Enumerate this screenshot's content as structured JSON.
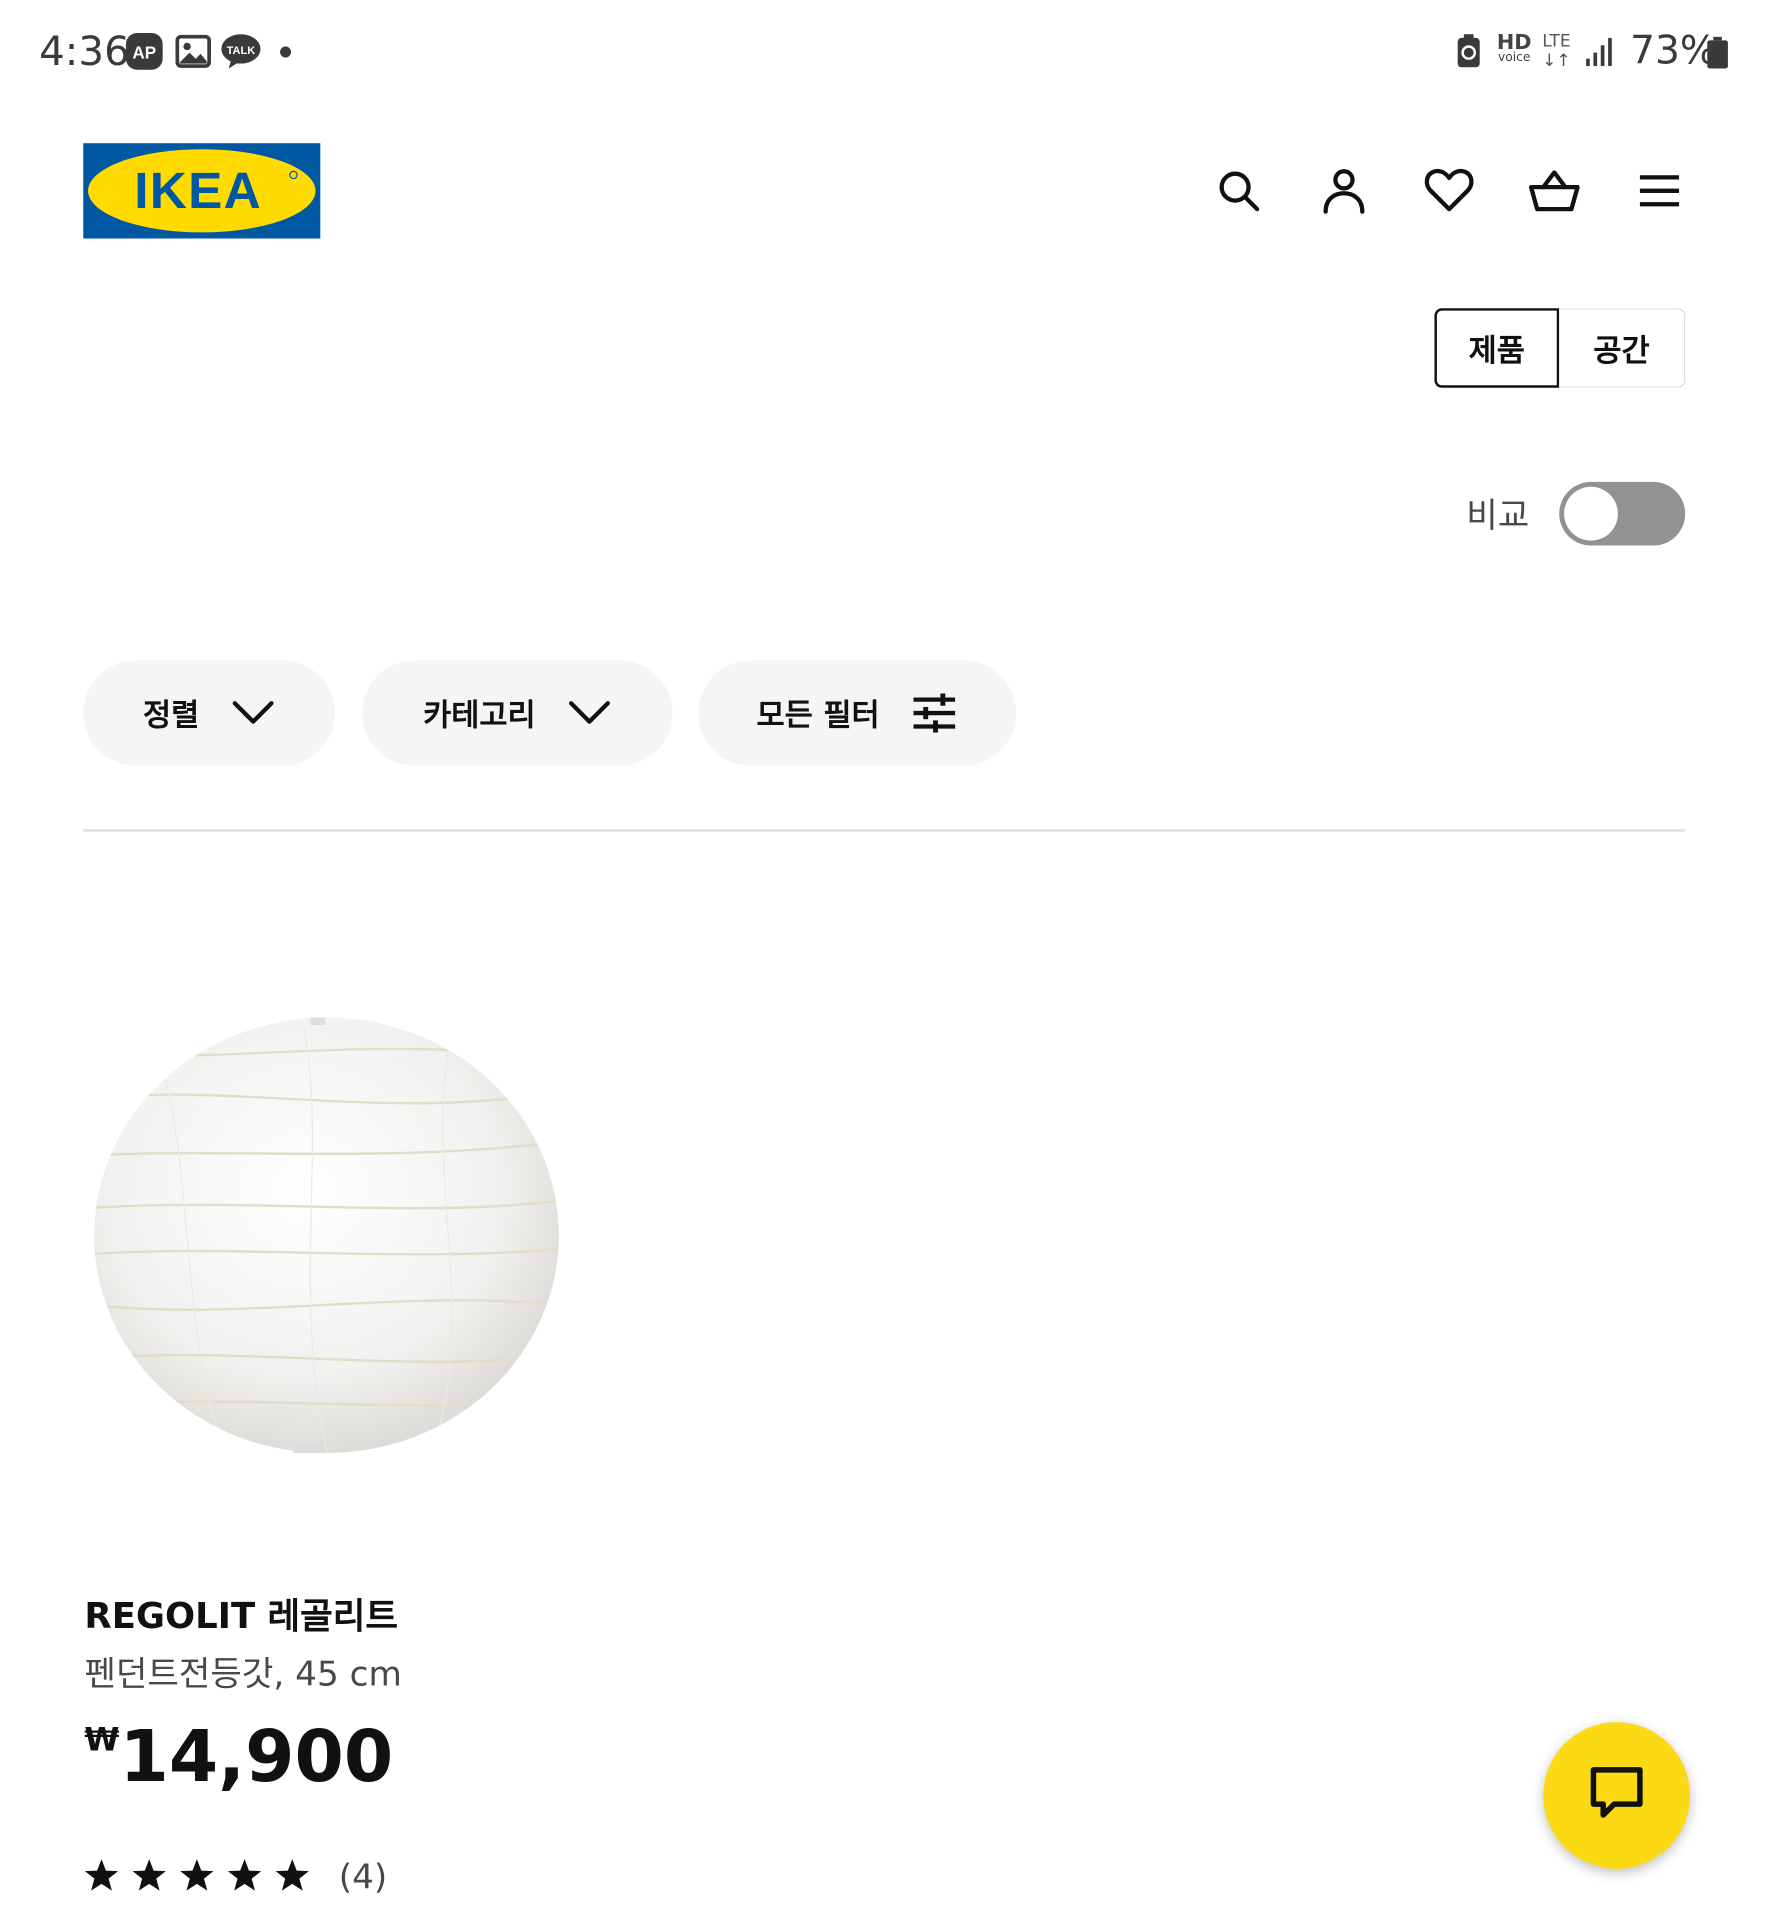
{
  "status_bar": {
    "time": "4:36",
    "notification_icons": [
      "ap-icon",
      "gallery-icon",
      "kakaotalk-icon",
      "dot"
    ],
    "talk_label": "TALK",
    "ap_label": "AP",
    "hd_label": "HD",
    "voice_label": "voice",
    "network": "LTE",
    "battery": "73%"
  },
  "header": {
    "logo_text": "IKEA",
    "icons": [
      "search-icon",
      "account-icon",
      "heart-icon",
      "cart-icon",
      "menu-icon"
    ]
  },
  "view_toggle": {
    "products_label": "제품",
    "rooms_label": "공간",
    "selected": "제품"
  },
  "compare": {
    "label": "비교",
    "enabled": false
  },
  "filters": {
    "sort_label": "정렬",
    "category_label": "카테고리",
    "all_filters_label": "모든 필터"
  },
  "product": {
    "name": "REGOLIT 레골리트",
    "description": "펜던트전등갓, 45 cm",
    "currency": "₩",
    "price": "14,900",
    "rating_stars": 5,
    "review_count": "(4)"
  },
  "colors": {
    "ikea_blue": "#0058a3",
    "ikea_yellow": "#ffdb00",
    "chat_fab": "#fbd914",
    "pill_bg": "#f5f5f5",
    "switch_off": "#929292"
  }
}
